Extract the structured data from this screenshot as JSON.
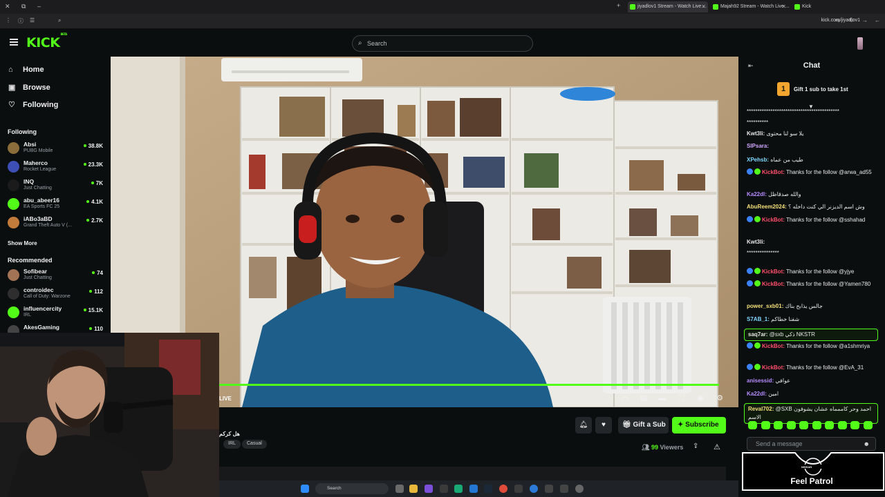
{
  "browser": {
    "tabs": [
      {
        "label": "jiyadlov1 Stream - Watch Live ...",
        "active": true
      },
      {
        "label": "Majah92 Stream - Watch Live ...",
        "active": false
      },
      {
        "label": "Kick",
        "active": false
      }
    ],
    "url": "kick.com/jiyadlov1"
  },
  "header": {
    "logo": "KICK",
    "logo_sup": "BETA",
    "search_placeholder": "Search"
  },
  "sidebar": {
    "nav": [
      {
        "label": "Home",
        "icon": "home-icon"
      },
      {
        "label": "Browse",
        "icon": "browse-icon"
      },
      {
        "label": "Following",
        "icon": "heart-icon"
      }
    ],
    "following_title": "Following",
    "following": [
      {
        "name": "Absi",
        "category": "PUBG Mobile",
        "viewers": "38.8K",
        "color": "#8a6d3b"
      },
      {
        "name": "Maherco",
        "category": "Rocket League",
        "viewers": "23.3K",
        "color": "#3d4fb5"
      },
      {
        "name": "INQ",
        "category": "Just Chatting",
        "viewers": "7K",
        "color": "#1b1b1b"
      },
      {
        "name": "abu_abeer16",
        "category": "EA Sports FC 25",
        "viewers": "4.1K",
        "color": "#53fc18"
      },
      {
        "name": "iABo3aBD",
        "category": "Grand Theft Auto V (...",
        "viewers": "2.7K",
        "color": "#c27b3a"
      }
    ],
    "show_more": "Show More",
    "recommended_title": "Recommended",
    "recommended": [
      {
        "name": "Sofibear",
        "category": "Just Chatting",
        "viewers": "74",
        "color": "#a27455"
      },
      {
        "name": "controidec",
        "category": "Call of Duty: Warzone",
        "viewers": "112",
        "color": "#2e2e2e"
      },
      {
        "name": "influencercity",
        "category": "IRL",
        "viewers": "15.1K",
        "color": "#53fc18"
      },
      {
        "name": "AkesGaming",
        "category": "",
        "viewers": "110",
        "color": "#444"
      }
    ]
  },
  "player": {
    "live_label": "LIVE",
    "progress": 1.0
  },
  "stream_info": {
    "title": "هل كركم",
    "tags": [
      "IRL",
      "Casual"
    ],
    "gift_label": "Gift a Sub",
    "subscribe_label": "Subscribe",
    "viewers_count": "99",
    "viewers_label": "Viewers"
  },
  "taskbar": {
    "search_placeholder": "Search"
  },
  "chat": {
    "title": "Chat",
    "gift_banner_rank": "1",
    "gift_banner_text": "Gift 1 sub to take 1st",
    "messages": [
      {
        "user": "",
        "text": "*******************************************",
        "color": "#e8e8e8"
      },
      {
        "user": "",
        "text": "**********",
        "color": "#e8e8e8"
      },
      {
        "user": "Kwt3li:",
        "text": "يلا سو لنا محتوى",
        "color": "#e8e8e8"
      },
      {
        "user": "SIPsara:",
        "text": "",
        "color": "#cfa7ff"
      },
      {
        "user": "XPehsb:",
        "text": "طيب من عماه",
        "color": "#7fd8ff"
      },
      {
        "user": "KickBot:",
        "text": "Thanks for the follow @arwa_ad55",
        "color": "#ff4f6d"
      },
      {
        "user": "Ka22dl:",
        "text": "والله صدقاظل",
        "color": "#b78cff"
      },
      {
        "user": "AbuReem2024:",
        "text": "وش اسم الديزنر الي كنت داخله ؟",
        "color": "#f4e07a"
      },
      {
        "user": "KickBot:",
        "text": "Thanks for the follow @sshahad",
        "color": "#ff4f6d"
      },
      {
        "user": "Kwt3li:",
        "text": "",
        "color": "#e8e8e8"
      },
      {
        "user": "",
        "text": "***************",
        "color": "#e8e8e8"
      },
      {
        "user": "KickBot:",
        "text": "Thanks for the follow @yjye",
        "color": "#ff4f6d"
      },
      {
        "user": "KickBot:",
        "text": "Thanks for the follow @Yamen780",
        "color": "#ff4f6d"
      },
      {
        "user": "power_sxb01:",
        "text": "جالس يذابح بناك",
        "color": "#f4e07a"
      },
      {
        "user": "S7AB_1:",
        "text": "شفنا خطاكم",
        "color": "#7fd8ff"
      },
      {
        "user": "saq7ar:",
        "text": "@sxb ذكي NKSTR",
        "color": "#e8e8e8"
      },
      {
        "user": "KickBot:",
        "text": "Thanks for the follow @a1shmriya",
        "color": "#ff4f6d"
      },
      {
        "user": "KickBot:",
        "text": "Thanks for the follow @EvA_31",
        "color": "#ff4f6d"
      },
      {
        "user": "anisessid:",
        "text": "عوافي",
        "color": "#b78cff"
      },
      {
        "user": "Ka22dl:",
        "text": "امين",
        "color": "#b78cff"
      },
      {
        "user": "Reval702:",
        "text": "@SXB احمد وحر كاممماه عشان يشوفون الاسم",
        "color": "#f4e07a"
      }
    ],
    "input_placeholder": "Send a message"
  },
  "overlay": {
    "brand": "NISSAN",
    "watermark_text": "Feel Patrol"
  }
}
